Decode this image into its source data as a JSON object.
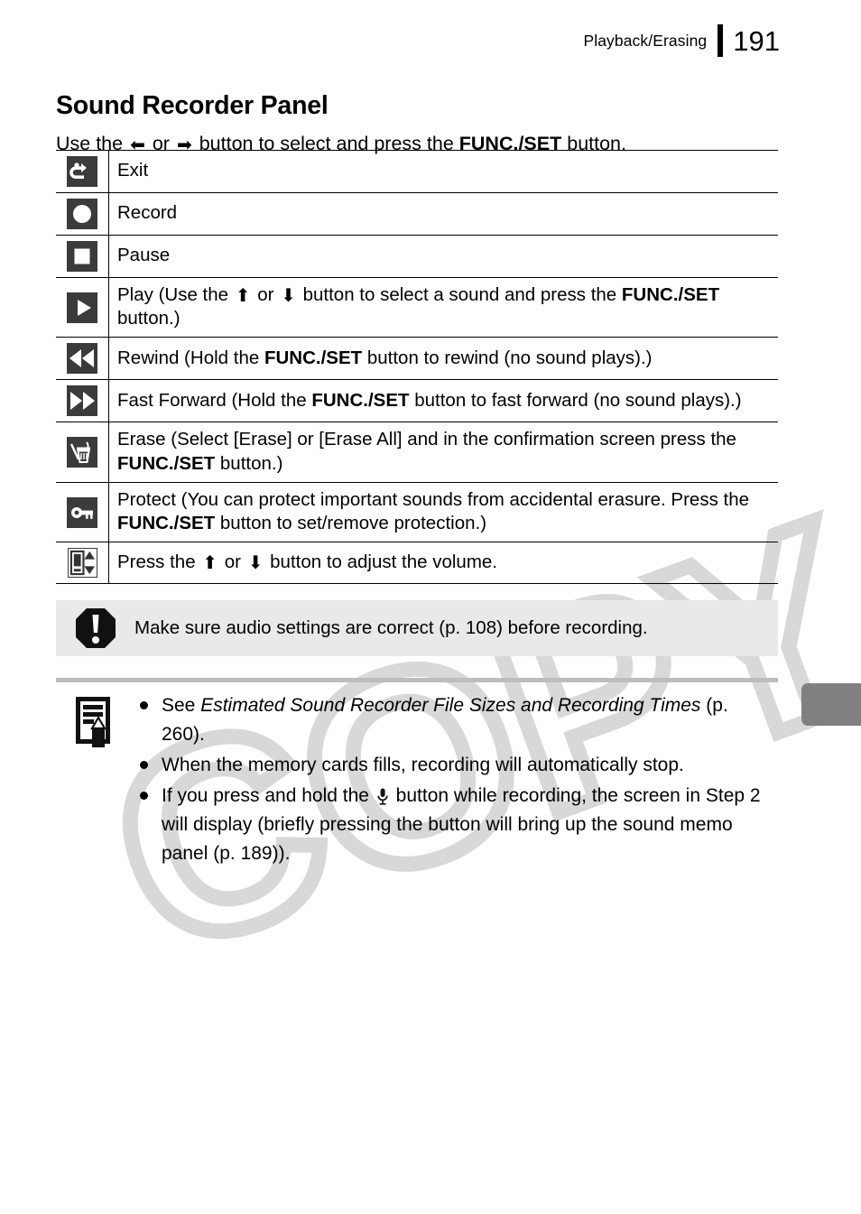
{
  "header": {
    "section_label": "Playback/Erasing",
    "page_number": "191"
  },
  "title": "Sound Recorder Panel",
  "intro": {
    "prefix": "Use the",
    "left_arrow": "⬅",
    "middle": "or",
    "right_arrow": "➡",
    "suffix_1": "button to select and press the",
    "bold": "FUNC./SET",
    "suffix_2": "button."
  },
  "table": {
    "rows": [
      {
        "icon": "exit-icon",
        "text_parts": [
          {
            "type": "plain",
            "text": "Exit"
          }
        ]
      },
      {
        "icon": "record-icon",
        "text_parts": [
          {
            "type": "plain",
            "text": "Record"
          }
        ]
      },
      {
        "icon": "pause-icon",
        "text_parts": [
          {
            "type": "plain",
            "text": "Pause"
          }
        ]
      },
      {
        "icon": "play-icon",
        "text_parts": [
          {
            "type": "plain",
            "text": "Play (Use the "
          },
          {
            "type": "arrow-up",
            "text": "⬆"
          },
          {
            "type": "plain",
            "text": " or "
          },
          {
            "type": "arrow-down",
            "text": "⬇"
          },
          {
            "type": "plain",
            "text": " button to select a sound and press the "
          },
          {
            "type": "bold",
            "text": "FUNC./SET"
          },
          {
            "type": "plain",
            "text": " button.)"
          }
        ]
      },
      {
        "icon": "rewind-icon",
        "text_parts": [
          {
            "type": "plain",
            "text": "Rewind (Hold the "
          },
          {
            "type": "bold",
            "text": "FUNC./SET"
          },
          {
            "type": "plain",
            "text": " button to rewind (no sound plays).)"
          }
        ]
      },
      {
        "icon": "fast-forward-icon",
        "text_parts": [
          {
            "type": "plain",
            "text": "Fast Forward (Hold the "
          },
          {
            "type": "bold",
            "text": "FUNC./SET"
          },
          {
            "type": "plain",
            "text": " button to fast forward (no sound plays).)"
          }
        ]
      },
      {
        "icon": "erase-icon",
        "text_parts": [
          {
            "type": "plain",
            "text": "Erase (Select [Erase] or [Erase All] and in the confirmation screen press the "
          },
          {
            "type": "bold",
            "text": "FUNC./SET"
          },
          {
            "type": "plain",
            "text": " button.)"
          }
        ]
      },
      {
        "icon": "protect-icon",
        "text_parts": [
          {
            "type": "plain",
            "text": "Protect (You can protect important sounds from accidental erasure. Press the "
          },
          {
            "type": "bold",
            "text": "FUNC./SET"
          },
          {
            "type": "plain",
            "text": " button to set/remove protection.)"
          }
        ]
      },
      {
        "icon": "volume-icon",
        "text_parts": [
          {
            "type": "plain",
            "text": "Press the "
          },
          {
            "type": "arrow-up",
            "text": "⬆"
          },
          {
            "type": "plain",
            "text": " or "
          },
          {
            "type": "arrow-down",
            "text": "⬇"
          },
          {
            "type": "plain",
            "text": " button to adjust the volume."
          }
        ]
      }
    ]
  },
  "caution": {
    "icon": "exclamation-octagon-icon",
    "text": "Make sure audio settings are correct (p. 108) before recording."
  },
  "note": {
    "icon": "note-pencil-icon",
    "items": [
      {
        "parts": [
          {
            "type": "plain",
            "text": "See "
          },
          {
            "type": "italic",
            "text": "Estimated Sound Recorder File Sizes and Recording Times"
          },
          {
            "type": "plain",
            "text": " (p. 260)."
          }
        ]
      },
      {
        "parts": [
          {
            "type": "plain",
            "text": "When the memory cards fills, recording will automatically stop."
          }
        ]
      },
      {
        "parts": [
          {
            "type": "plain",
            "text": "If you press and hold the "
          },
          {
            "type": "mic",
            "text": ""
          },
          {
            "type": "plain",
            "text": " button while recording, the screen in Step 2 will display (briefly pressing the button will bring up the sound memo panel (p. 189))."
          }
        ]
      }
    ]
  },
  "watermark": {
    "text": "COPY",
    "color": "#d8d8d8"
  },
  "thumb_tab": {
    "color": "#808080"
  },
  "colors": {
    "icon_dark": "#3b3b3b",
    "caution_band": "#e9e9e9",
    "note_rule": "#bdbdbd"
  }
}
